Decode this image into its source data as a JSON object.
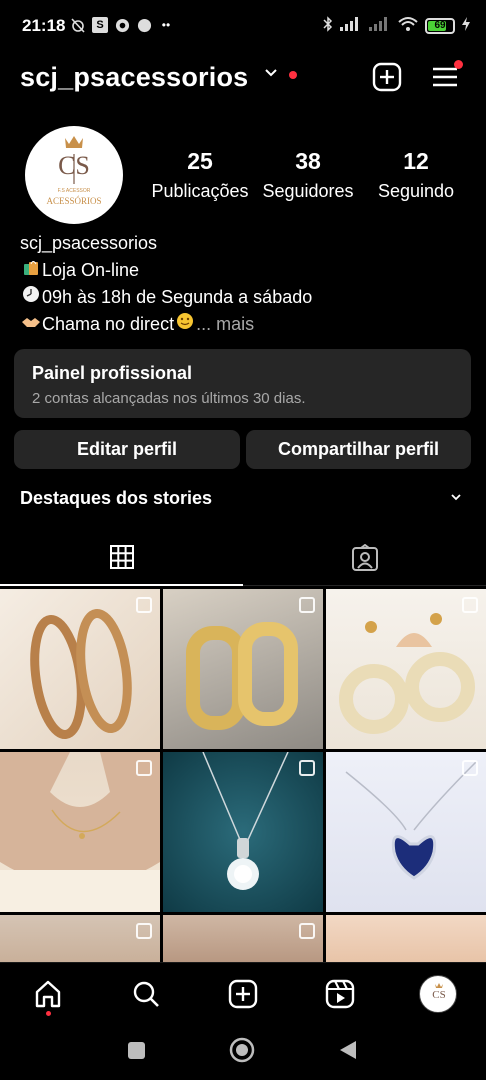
{
  "status_bar": {
    "time": "21:18",
    "battery": "69"
  },
  "header": {
    "username": "scj_psacessorios"
  },
  "profile": {
    "avatar_brand": "ACESSÓRIOS",
    "avatar_subtitle": "F.S ACESSOR",
    "stats": [
      {
        "count": "25",
        "label": "Publicações"
      },
      {
        "count": "38",
        "label": "Seguidores"
      },
      {
        "count": "12",
        "label": "Seguindo"
      }
    ],
    "bio": {
      "name": "scj_psacessorios",
      "line1": "Loja On-line",
      "line2": "09h às 18h de Segunda a sábado",
      "line3": "Chama no direct",
      "more": "... mais"
    }
  },
  "panel": {
    "title": "Painel profissional",
    "subtitle": "2 contas alcançadas nos últimos 30 dias."
  },
  "buttons": {
    "edit": "Editar perfil",
    "share": "Compartilhar perfil"
  },
  "highlights": {
    "title": "Destaques dos stories"
  },
  "grid": {
    "posts": [
      {
        "subject": "gold hoop earrings"
      },
      {
        "subject": "gold crystal huggie earrings"
      },
      {
        "subject": "white woven circle earrings"
      },
      {
        "subject": "woman wearing gold necklace"
      },
      {
        "subject": "diamond pendant necklace"
      },
      {
        "subject": "blue heart pendant necklace"
      },
      {
        "subject": "necklace on model"
      },
      {
        "subject": "jewelry on model"
      },
      {
        "subject": "ring close-up"
      }
    ]
  },
  "colors": {
    "background": "#000000",
    "surface": "#262626",
    "muted_text": "#a8a8a8",
    "notification": "#ff3040"
  }
}
